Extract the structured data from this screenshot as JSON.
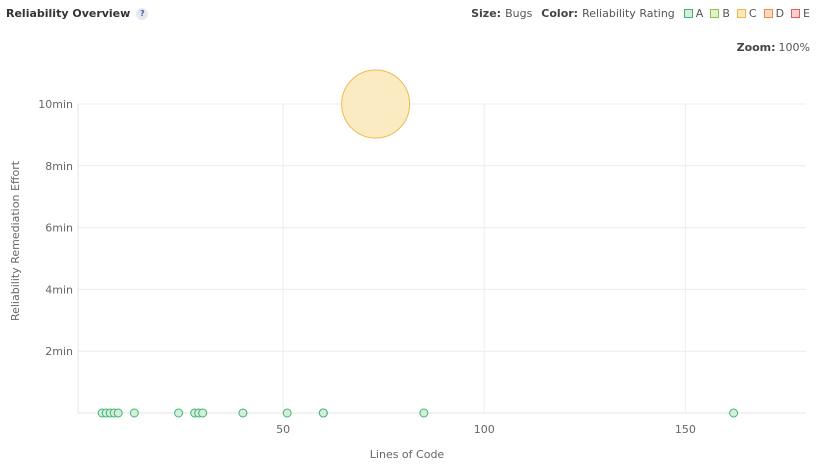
{
  "header": {
    "title": "Reliability Overview",
    "help_symbol": "?"
  },
  "legend": {
    "size_label": "Size:",
    "size_value": "Bugs",
    "color_label": "Color:",
    "color_value": "Reliability Rating",
    "ratings": [
      {
        "label": "A",
        "fill": "#d4eedc",
        "border": "#3fb56f"
      },
      {
        "label": "B",
        "fill": "#e3f3c8",
        "border": "#8bc34a"
      },
      {
        "label": "C",
        "fill": "#fbeac0",
        "border": "#f0b84a"
      },
      {
        "label": "D",
        "fill": "#fbd9bf",
        "border": "#ef8d49"
      },
      {
        "label": "E",
        "fill": "#f8d2d2",
        "border": "#e35c5c"
      }
    ]
  },
  "zoom": {
    "label": "Zoom:",
    "value": "100%"
  },
  "chart_data": {
    "type": "scatter",
    "xlabel": "Lines of Code",
    "ylabel": "Reliability Remediation Effort",
    "xlim": [
      -1,
      180
    ],
    "ylim": [
      0,
      10
    ],
    "x_ticks": [
      {
        "value": 50,
        "label": "50"
      },
      {
        "value": 100,
        "label": "100"
      },
      {
        "value": 150,
        "label": "150"
      }
    ],
    "y_ticks": [
      {
        "value": 2,
        "label": "2min"
      },
      {
        "value": 4,
        "label": "4min"
      },
      {
        "value": 6,
        "label": "6min"
      },
      {
        "value": 8,
        "label": "8min"
      },
      {
        "value": 10,
        "label": "10min"
      }
    ],
    "grid": true,
    "points": [
      {
        "x": 5,
        "y": 0,
        "rating": "A",
        "bugs": 0
      },
      {
        "x": 6,
        "y": 0,
        "rating": "A",
        "bugs": 0
      },
      {
        "x": 7,
        "y": 0,
        "rating": "A",
        "bugs": 0
      },
      {
        "x": 8,
        "y": 0,
        "rating": "A",
        "bugs": 0
      },
      {
        "x": 9,
        "y": 0,
        "rating": "A",
        "bugs": 0
      },
      {
        "x": 13,
        "y": 0,
        "rating": "A",
        "bugs": 0
      },
      {
        "x": 24,
        "y": 0,
        "rating": "A",
        "bugs": 0
      },
      {
        "x": 28,
        "y": 0,
        "rating": "A",
        "bugs": 0
      },
      {
        "x": 29,
        "y": 0,
        "rating": "A",
        "bugs": 0
      },
      {
        "x": 30,
        "y": 0,
        "rating": "A",
        "bugs": 0
      },
      {
        "x": 40,
        "y": 0,
        "rating": "A",
        "bugs": 0
      },
      {
        "x": 51,
        "y": 0,
        "rating": "A",
        "bugs": 0
      },
      {
        "x": 60,
        "y": 0,
        "rating": "A",
        "bugs": 0
      },
      {
        "x": 60,
        "y": 0,
        "rating": "A",
        "bugs": 0
      },
      {
        "x": 85,
        "y": 0,
        "rating": "A",
        "bugs": 0
      },
      {
        "x": 162,
        "y": 0,
        "rating": "A",
        "bugs": 0
      },
      {
        "x": 73,
        "y": 10,
        "rating": "C",
        "bugs": 1
      }
    ]
  }
}
